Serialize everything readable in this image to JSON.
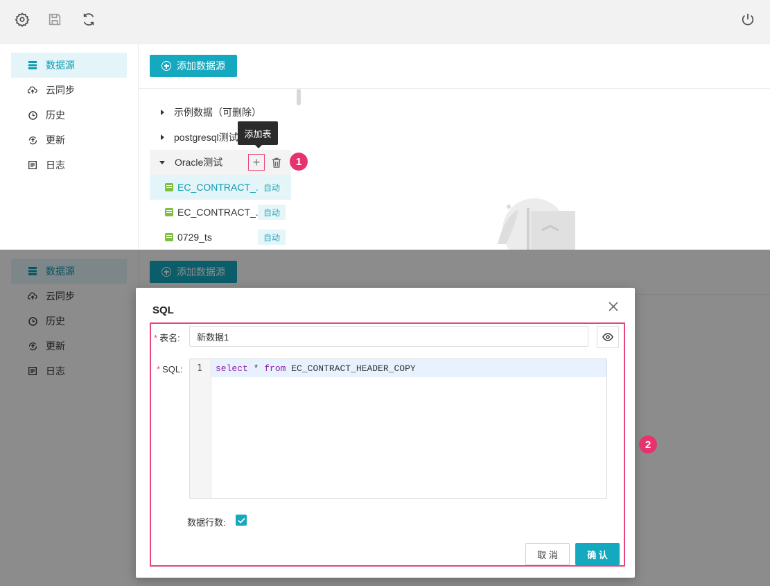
{
  "topbar": {
    "icons": [
      "settings-icon",
      "save-icon",
      "refresh-icon",
      "power-icon"
    ]
  },
  "sidebar": {
    "items": [
      {
        "label": "数据源",
        "icon": "datasource-icon",
        "active": true
      },
      {
        "label": "云同步",
        "icon": "cloud-sync-icon",
        "active": false
      },
      {
        "label": "历史",
        "icon": "history-clock-icon",
        "active": false
      },
      {
        "label": "更新",
        "icon": "update-icon",
        "active": false
      },
      {
        "label": "日志",
        "icon": "log-icon",
        "active": false
      }
    ]
  },
  "toolbar": {
    "add_datasource_label": "添加数据源"
  },
  "tree": {
    "nodes": [
      {
        "label": "示例数据（可删除）",
        "expanded": false
      },
      {
        "label": "postgresql测试",
        "expanded": false
      },
      {
        "label": "Oracle测试",
        "expanded": true
      }
    ],
    "tables": [
      {
        "name": "EC_CONTRACT_...",
        "tag": "自动",
        "selected": true
      },
      {
        "name": "EC_CONTRACT_...",
        "tag": "自动",
        "selected": false
      },
      {
        "name": "0729_ts",
        "tag": "自动",
        "selected": false
      }
    ],
    "add_table_symbol": "+"
  },
  "tooltip": {
    "text": "添加表"
  },
  "markers": {
    "one": "1",
    "two": "2"
  },
  "modal": {
    "title": "SQL",
    "table_name_label": "表名:",
    "table_name_value": "新数据1",
    "sql_label": "SQL:",
    "required_mark": "*",
    "line_number": "1",
    "sql_keyword_select": "select",
    "sql_star": " * ",
    "sql_keyword_from": "from",
    "sql_table": " EC_CONTRACT_HEADER_COPY",
    "rows_label": "数据行数:",
    "rows_checked": true,
    "cancel_label": "取 消",
    "ok_label": "确 认"
  },
  "colors": {
    "accent": "#14a9bf",
    "highlight": "#e6457a",
    "selected_bg": "#e3f5f8"
  }
}
